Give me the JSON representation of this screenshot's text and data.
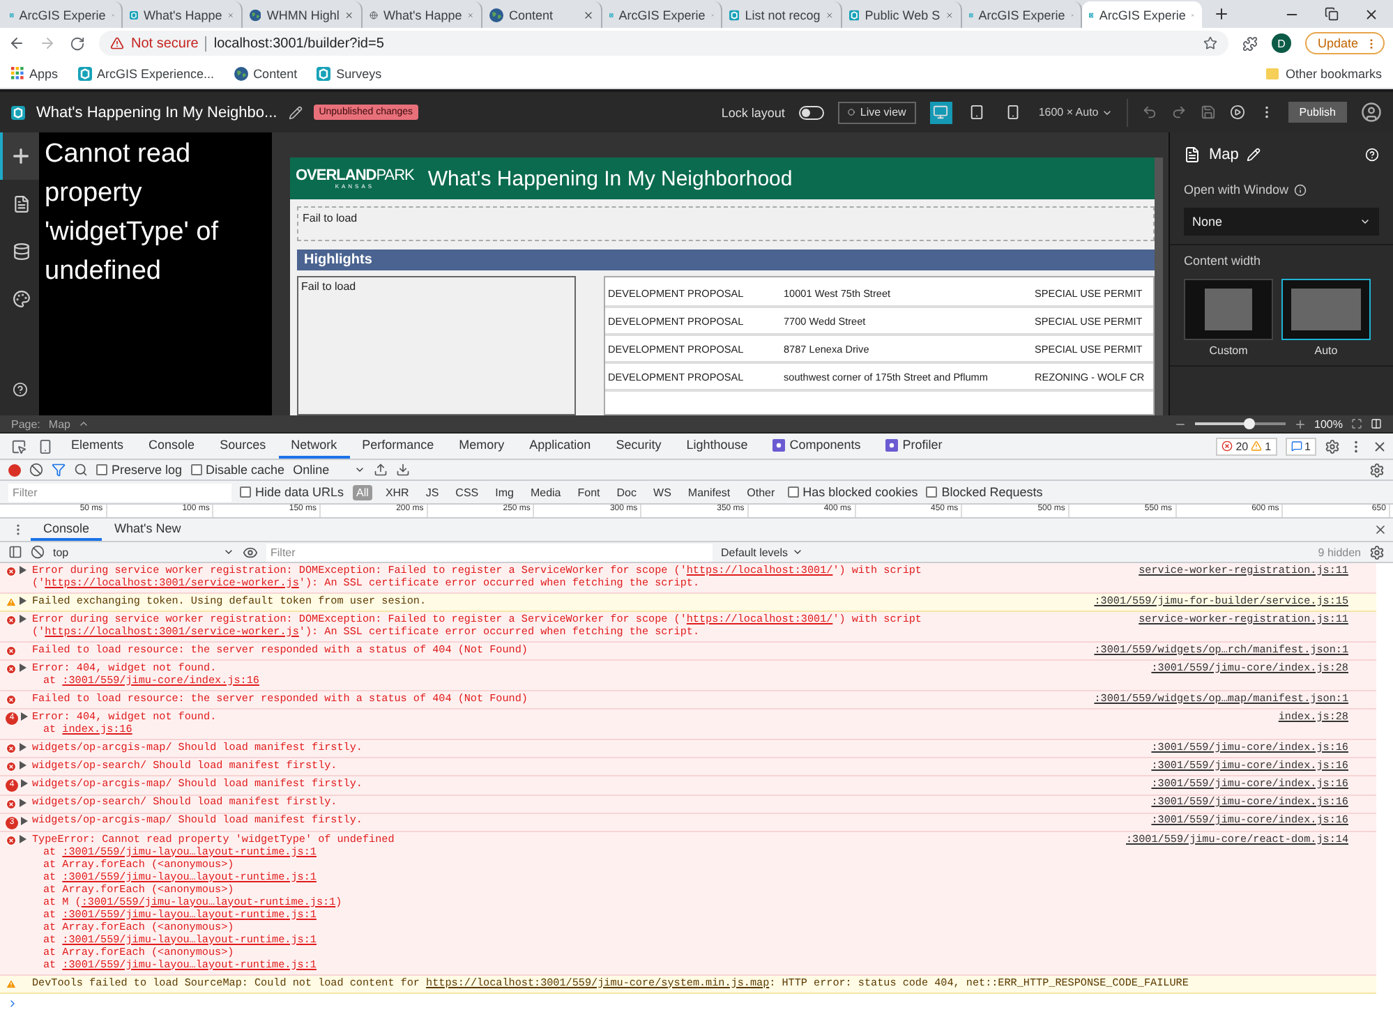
{
  "browser": {
    "tabs": [
      {
        "title": "ArcGIS Experie",
        "kind": "app",
        "selected": false
      },
      {
        "title": "What's Happe",
        "kind": "app",
        "selected": false
      },
      {
        "title": "WHMN Highl",
        "kind": "earth",
        "selected": false
      },
      {
        "title": "What's Happe",
        "kind": "globe",
        "selected": false
      },
      {
        "title": "Content",
        "kind": "earth",
        "selected": false
      },
      {
        "title": "ArcGIS Experie",
        "kind": "app",
        "selected": false
      },
      {
        "title": "List not recog",
        "kind": "app",
        "selected": false
      },
      {
        "title": "Public Web S",
        "kind": "app",
        "selected": false
      },
      {
        "title": "ArcGIS Experie",
        "kind": "app",
        "selected": false
      },
      {
        "title": "ArcGIS Experie",
        "kind": "app",
        "selected": true
      }
    ],
    "address": {
      "security": "Not secure",
      "url": "localhost:3001/builder?id=5"
    },
    "profile": "D",
    "update": "Update",
    "bookmarks": [
      {
        "label": "Apps",
        "kind": "apps"
      },
      {
        "label": "ArcGIS Experience...",
        "kind": "app"
      },
      {
        "label": "Content",
        "kind": "earth"
      },
      {
        "label": "Surveys",
        "kind": "app"
      }
    ],
    "other_bookmarks": "Other bookmarks"
  },
  "builder": {
    "title": "What's Happening In My Neighbo...",
    "badge": "Unpublished changes",
    "lock_layout": {
      "label": "Lock layout",
      "on": false
    },
    "live_view": "Live view",
    "devices": [
      {
        "kind": "desktop",
        "selected": true
      },
      {
        "kind": "tablet",
        "selected": false
      },
      {
        "kind": "phone",
        "selected": false
      }
    ],
    "size": "1600 × Auto",
    "publish": "Publish",
    "tools": [
      {
        "kind": "add",
        "selected": true
      },
      {
        "kind": "page",
        "selected": false
      },
      {
        "kind": "data",
        "selected": false
      },
      {
        "kind": "theme",
        "selected": false
      }
    ],
    "error": "Cannot read property 'widgetType' of undefined",
    "page": {
      "logo": [
        "OVERLAND",
        "PARK"
      ],
      "logo_sub": "KANSAS",
      "title": "What's Happening In My Neighborhood",
      "fail_top": "Fail to load",
      "section": "Highlights",
      "fail_side": "Fail to load",
      "rows": [
        [
          "DEVELOPMENT PROPOSAL",
          "10001 West 75th Street",
          "SPECIAL USE PERMIT"
        ],
        [
          "DEVELOPMENT PROPOSAL",
          "7700 Wedd Street",
          "SPECIAL USE PERMIT"
        ],
        [
          "DEVELOPMENT PROPOSAL",
          "8787 Lenexa Drive",
          "SPECIAL USE PERMIT"
        ],
        [
          "DEVELOPMENT PROPOSAL",
          "southwest corner of 175th Street and Pflumm",
          "REZONING - WOLF CR"
        ]
      ]
    },
    "panel": {
      "title": "Map",
      "open_with": "Open with Window",
      "select": "None",
      "content_width": "Content width",
      "options": [
        {
          "label": "Custom",
          "selected": false
        },
        {
          "label": "Auto",
          "selected": true
        }
      ]
    },
    "page_bar": {
      "label": "Page:",
      "page": "Map",
      "zoom": "100%",
      "level": 0.6
    }
  },
  "devtools": {
    "tabs": [
      {
        "label": "Elements",
        "kind": "plain",
        "selected": false
      },
      {
        "label": "Console",
        "kind": "plain",
        "selected": false
      },
      {
        "label": "Sources",
        "kind": "plain",
        "selected": false
      },
      {
        "label": "Network",
        "kind": "plain",
        "selected": true
      },
      {
        "label": "Performance",
        "kind": "plain",
        "selected": false
      },
      {
        "label": "Memory",
        "kind": "plain",
        "selected": false
      },
      {
        "label": "Application",
        "kind": "plain",
        "selected": false
      },
      {
        "label": "Security",
        "kind": "plain",
        "selected": false
      },
      {
        "label": "Lighthouse",
        "kind": "plain",
        "selected": false
      },
      {
        "label": "Components",
        "kind": "extension",
        "selected": false
      },
      {
        "label": "Profiler",
        "kind": "extension",
        "selected": false
      }
    ],
    "counts": {
      "errors": "20",
      "warnings": "1",
      "messages": "1"
    },
    "network": {
      "preserve_log": {
        "label": "Preserve log",
        "checked": false
      },
      "disable_cache": {
        "label": "Disable cache",
        "checked": false
      },
      "throttle": "Online"
    },
    "filter": {
      "placeholder": "Filter",
      "hide_data_urls": {
        "label": "Hide data URLs",
        "checked": false
      },
      "types": [
        {
          "label": "All",
          "selected": true
        },
        {
          "label": "XHR",
          "selected": false
        },
        {
          "label": "JS",
          "selected": false
        },
        {
          "label": "CSS",
          "selected": false
        },
        {
          "label": "Img",
          "selected": false
        },
        {
          "label": "Media",
          "selected": false
        },
        {
          "label": "Font",
          "selected": false
        },
        {
          "label": "Doc",
          "selected": false
        },
        {
          "label": "WS",
          "selected": false
        },
        {
          "label": "Manifest",
          "selected": false
        },
        {
          "label": "Other",
          "selected": false
        }
      ],
      "blocked_cookies": {
        "label": "Has blocked cookies",
        "checked": false
      },
      "blocked_requests": {
        "label": "Blocked Requests",
        "checked": false
      }
    },
    "ruler": [
      "50 ms",
      "100 ms",
      "150 ms",
      "200 ms",
      "250 ms",
      "300 ms",
      "350 ms",
      "400 ms",
      "450 ms",
      "500 ms",
      "550 ms",
      "600 ms",
      "650"
    ],
    "drawer_tabs": [
      {
        "label": "Console",
        "selected": true
      },
      {
        "label": "What's New",
        "selected": false
      }
    ],
    "console": {
      "context": "top",
      "filter_placeholder": "Filter",
      "levels": "Default levels",
      "hidden": "9 hidden",
      "messages": [
        {
          "kind": "error",
          "expandable": true,
          "parts": [
            {
              "text": "Error during service worker registration: DOMException: Failed to register a ServiceWorker for scope ('",
              "link": false
            },
            {
              "text": "https://localhost:3001/",
              "link": true
            },
            {
              "text": "') with script ('",
              "link": false
            },
            {
              "text": "https://localhost:3001/service-worker.js",
              "link": true
            },
            {
              "text": "'): An SSL certificate error occurred when fetching the script.",
              "link": false
            }
          ],
          "source": "service-worker-registration.js:11"
        },
        {
          "kind": "warning",
          "expandable": true,
          "parts": [
            {
              "text": "Failed exchanging token. Using default token from user sesion.",
              "link": false
            }
          ],
          "source": ":3001/559/jimu-for-builder/service.js:15"
        },
        {
          "kind": "error",
          "expandable": true,
          "parts": [
            {
              "text": "Error during service worker registration: DOMException: Failed to register a ServiceWorker for scope ('",
              "link": false
            },
            {
              "text": "https://localhost:3001/",
              "link": true
            },
            {
              "text": "') with script ('",
              "link": false
            },
            {
              "text": "https://localhost:3001/service-worker.js",
              "link": true
            },
            {
              "text": "'): An SSL certificate error occurred when fetching the script.",
              "link": false
            }
          ],
          "source": "service-worker-registration.js:11"
        },
        {
          "kind": "error",
          "expandable": false,
          "parts": [
            {
              "text": "Failed to load resource: the server responded with a status of 404 (Not Found)",
              "link": false
            }
          ],
          "source": ":3001/559/widgets/op…rch/manifest.json:1"
        },
        {
          "kind": "error",
          "expandable": true,
          "parts": [
            {
              "text": "Error: 404, widget not found.",
              "link": false
            }
          ],
          "source": ":3001/559/jimu-core/index.js:28",
          "stack": [
            [
              {
                "text": "at ",
                "link": false
              },
              {
                "text": ":3001/559/jimu-core/index.js:16",
                "link": true
              }
            ]
          ]
        },
        {
          "kind": "error",
          "expandable": false,
          "parts": [
            {
              "text": "Failed to load resource: the server responded with a status of 404 (Not Found)",
              "link": false
            }
          ],
          "source": ":3001/559/widgets/op…map/manifest.json:1"
        },
        {
          "kind": "error",
          "count": "4",
          "expandable": true,
          "parts": [
            {
              "text": "Error: 404, widget not found.",
              "link": false
            }
          ],
          "source": "index.js:28",
          "stack": [
            [
              {
                "text": "at ",
                "link": false
              },
              {
                "text": "index.js:16",
                "link": true
              }
            ]
          ]
        },
        {
          "kind": "error",
          "expandable": true,
          "parts": [
            {
              "text": "widgets/op-arcgis-map/ Should load manifest firstly.",
              "link": false
            }
          ],
          "source": ":3001/559/jimu-core/index.js:16"
        },
        {
          "kind": "error",
          "expandable": true,
          "parts": [
            {
              "text": "widgets/op-search/ Should load manifest firstly.",
              "link": false
            }
          ],
          "source": ":3001/559/jimu-core/index.js:16"
        },
        {
          "kind": "error",
          "count": "4",
          "expandable": true,
          "parts": [
            {
              "text": "widgets/op-arcgis-map/ Should load manifest firstly.",
              "link": false
            }
          ],
          "source": ":3001/559/jimu-core/index.js:16"
        },
        {
          "kind": "error",
          "expandable": true,
          "parts": [
            {
              "text": "widgets/op-search/ Should load manifest firstly.",
              "link": false
            }
          ],
          "source": ":3001/559/jimu-core/index.js:16"
        },
        {
          "kind": "error",
          "count": "3",
          "expandable": true,
          "parts": [
            {
              "text": "widgets/op-arcgis-map/ Should load manifest firstly.",
              "link": false
            }
          ],
          "source": ":3001/559/jimu-core/index.js:16"
        },
        {
          "kind": "error",
          "expandable": true,
          "parts": [
            {
              "text": "TypeError: Cannot read property 'widgetType' of undefined",
              "link": false
            }
          ],
          "source": ":3001/559/jimu-core/react-dom.js:14",
          "stack": [
            [
              {
                "text": "at ",
                "link": false
              },
              {
                "text": ":3001/559/jimu-layou…layout-runtime.js:1",
                "link": true
              }
            ],
            [
              {
                "text": "at Array.forEach (<anonymous>)",
                "link": false
              }
            ],
            [
              {
                "text": "at ",
                "link": false
              },
              {
                "text": ":3001/559/jimu-layou…layout-runtime.js:1",
                "link": true
              }
            ],
            [
              {
                "text": "at Array.forEach (<anonymous>)",
                "link": false
              }
            ],
            [
              {
                "text": "at M (",
                "link": false
              },
              {
                "text": ":3001/559/jimu-layou…layout-runtime.js:1",
                "link": true
              },
              {
                "text": ")",
                "link": false
              }
            ],
            [
              {
                "text": "at ",
                "link": false
              },
              {
                "text": ":3001/559/jimu-layou…layout-runtime.js:1",
                "link": true
              }
            ],
            [
              {
                "text": "at Array.forEach (<anonymous>)",
                "link": false
              }
            ],
            [
              {
                "text": "at ",
                "link": false
              },
              {
                "text": ":3001/559/jimu-layou…layout-runtime.js:1",
                "link": true
              }
            ],
            [
              {
                "text": "at Array.forEach (<anonymous>)",
                "link": false
              }
            ],
            [
              {
                "text": "at ",
                "link": false
              },
              {
                "text": ":3001/559/jimu-layou…layout-runtime.js:1",
                "link": true
              }
            ]
          ]
        },
        {
          "kind": "warning",
          "expandable": false,
          "parts": [
            {
              "text": "DevTools failed to load SourceMap: Could not load content for ",
              "link": false
            },
            {
              "text": "https://localhost:3001/559/jimu-core/system.min.js.map",
              "link": true
            },
            {
              "text": ": HTTP error: status code 404, net::ERR_HTTP_RESPONSE_CODE_FAILURE",
              "link": false
            }
          ]
        }
      ]
    }
  }
}
